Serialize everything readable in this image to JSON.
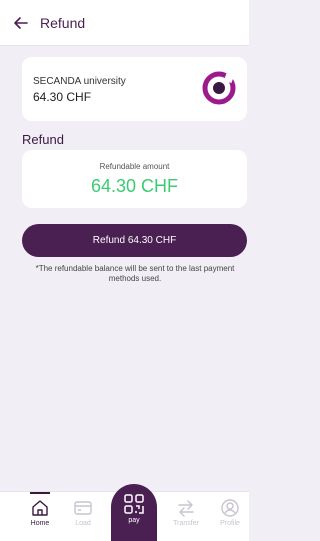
{
  "header": {
    "title": "Refund",
    "back_icon": "arrow-left-icon"
  },
  "merchant": {
    "name": "SECANDA university",
    "amount": "64.30 CHF",
    "logo_icon": "ring-logo-icon",
    "logo_color": "#9b1b8f"
  },
  "refund": {
    "section_title": "Refund",
    "label": "Refundable amount",
    "amount": "64.30 CHF",
    "amount_color": "#3bcb73",
    "button_label": "Refund 64.30 CHF",
    "note": "*The refundable balance will be sent to the last payment methods used."
  },
  "bottom_nav": {
    "home": {
      "label": "Home",
      "icon": "home-icon"
    },
    "load": {
      "label": "Load",
      "icon": "card-icon"
    },
    "pay": {
      "label": "pay",
      "icon": "qr-code-icon"
    },
    "transfer": {
      "label": "Transfer",
      "icon": "transfer-arrows-icon"
    },
    "profile": {
      "label": "Profile",
      "icon": "profile-icon"
    }
  },
  "colors": {
    "primary": "#4a1f52",
    "background": "#f1eff5",
    "muted": "#c8c3cf"
  }
}
